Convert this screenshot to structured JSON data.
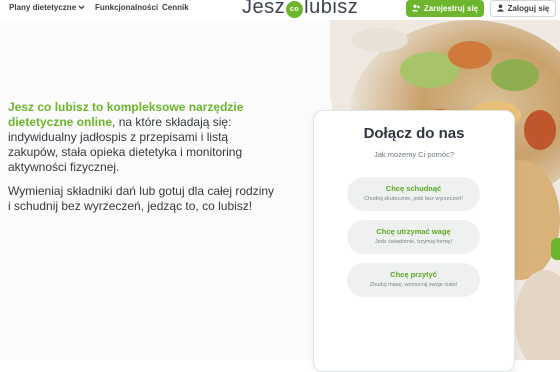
{
  "nav": {
    "items": [
      {
        "label": "Plany dietetyczne",
        "has_dropdown": true
      },
      {
        "label": "Funkcjonalności",
        "has_dropdown": false
      },
      {
        "label": "Cennik",
        "has_dropdown": false
      }
    ],
    "logo": {
      "left": "Jesz",
      "badge": "co",
      "right": "lubisz"
    },
    "register_label": "Zarejestruj się",
    "login_label": "Zaloguj się"
  },
  "hero": {
    "accent": "Jesz co lubisz to kompleksowe narzędzie dietetyczne online",
    "text1": ", na które składają się: indywidualny jadłospis z przepisami i listą zakupów, stała opieka dietetyka i monitoring aktywności fizycznej.",
    "text2": "Wymieniaj składniki dań lub gotuj dla całej rodziny i schudnij bez wyrzeczeń, jedząc to, co lubisz!"
  },
  "card": {
    "title": "Dołącz do nas",
    "subtitle": "Jak możemy Ci pomóc?",
    "options": [
      {
        "title": "Chcę schudnąć",
        "desc": "Chudnij skutecznie, jedz bez wyrzeczeń!"
      },
      {
        "title": "Chcę utrzymać wagę",
        "desc": "Jedz świadomie, trzymaj formę!"
      },
      {
        "title": "Chcę przytyć",
        "desc": "Zbuduj masę, wzmocnij swoje ciało!"
      }
    ]
  },
  "colors": {
    "brand_green": "#6cb52d",
    "text_dark": "#2f3640",
    "option_bg": "#eff1f1"
  },
  "icons": [
    "chevron-down-icon",
    "user-plus-icon",
    "user-icon"
  ]
}
